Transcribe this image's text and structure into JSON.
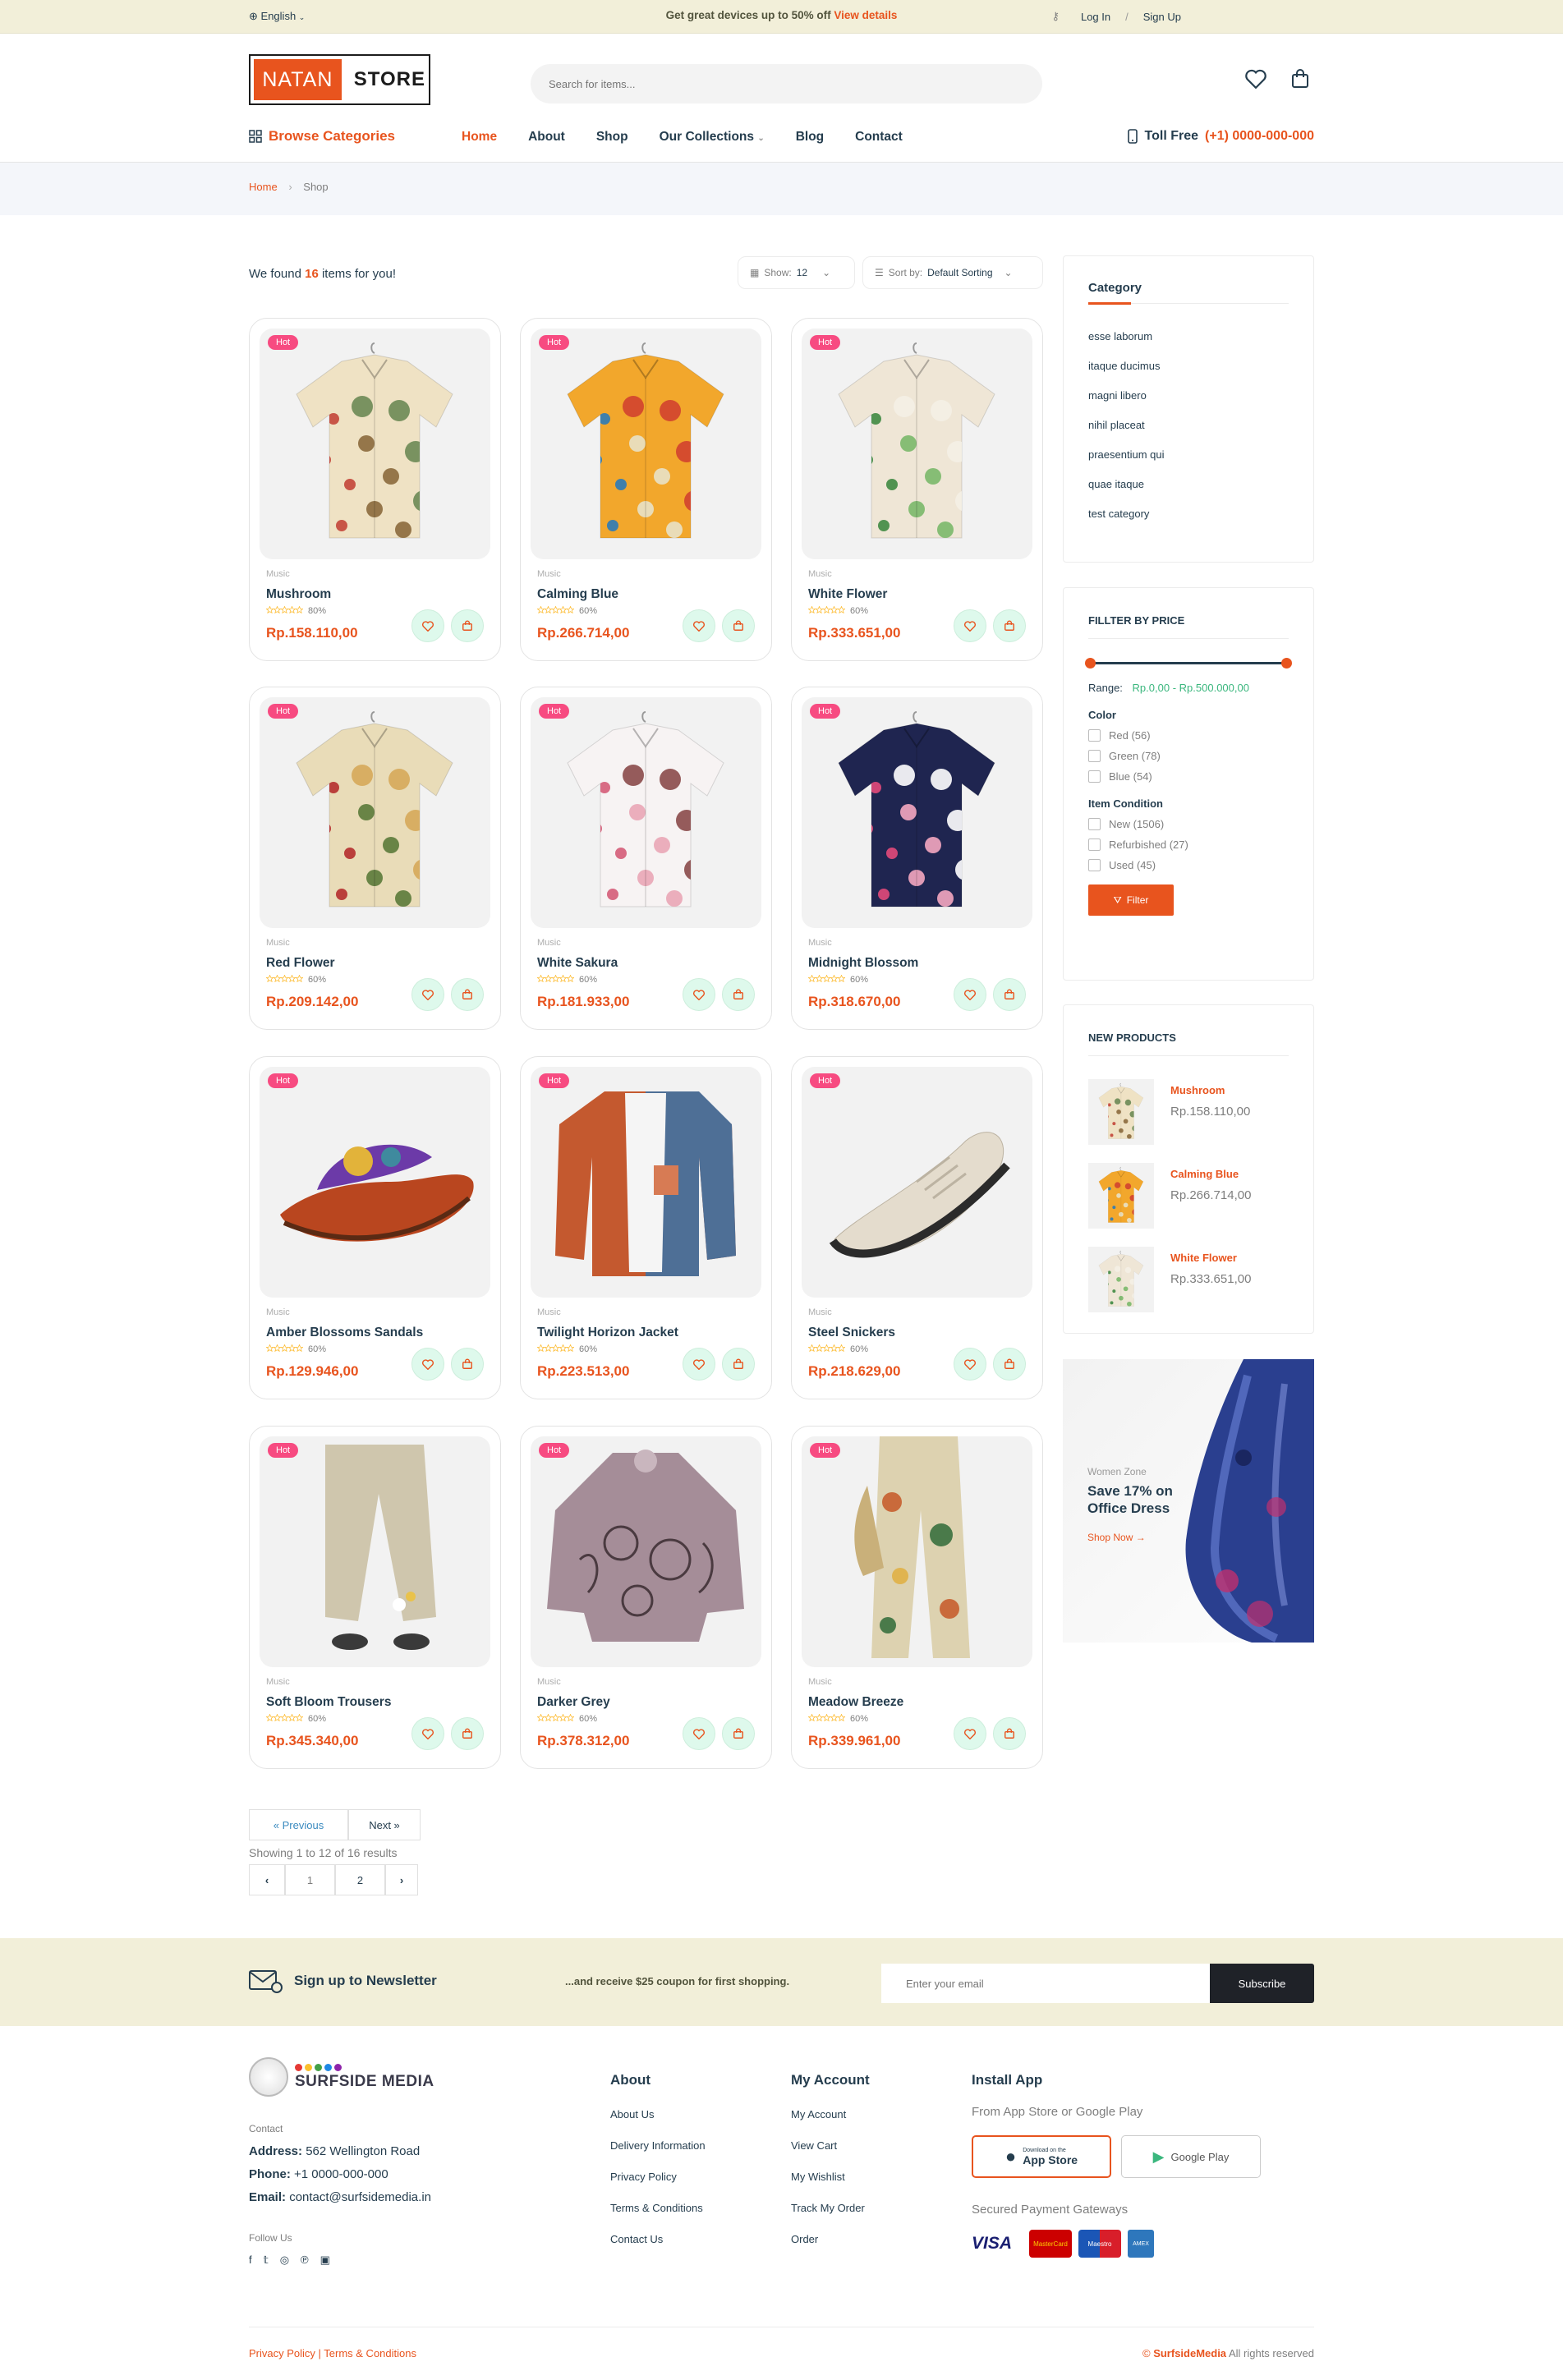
{
  "topbar": {
    "language": "English",
    "promo_text": "Get great devices up to 50% off",
    "promo_link": "View details",
    "login": "Log In",
    "separator": "/",
    "signup": "Sign Up"
  },
  "header": {
    "logo_part1": "NATAN",
    "logo_part2": "STORE",
    "search_placeholder": "Search for items..."
  },
  "nav": {
    "browse": "Browse Categories",
    "items": [
      "Home",
      "About",
      "Shop",
      "Our Collections",
      "Blog",
      "Contact"
    ],
    "toll_label": "Toll Free",
    "toll_number": "(+1) 0000-000-000"
  },
  "breadcrumb": {
    "home": "Home",
    "sep": "›",
    "current": "Shop"
  },
  "listing": {
    "found_prefix": "We found",
    "found_count": "16",
    "found_suffix": "items for you!",
    "show_label": "Show:",
    "show_value": "12",
    "sort_label": "Sort by:",
    "sort_value": "Default Sorting"
  },
  "products": [
    {
      "badge": "Hot",
      "category": "Music",
      "name": "Mushroom",
      "rating": "80%",
      "price": "Rp.158.110,00"
    },
    {
      "badge": "Hot",
      "category": "Music",
      "name": "Calming Blue",
      "rating": "60%",
      "price": "Rp.266.714,00"
    },
    {
      "badge": "Hot",
      "category": "Music",
      "name": "White Flower",
      "rating": "60%",
      "price": "Rp.333.651,00"
    },
    {
      "badge": "Hot",
      "category": "Music",
      "name": "Red Flower",
      "rating": "60%",
      "price": "Rp.209.142,00"
    },
    {
      "badge": "Hot",
      "category": "Music",
      "name": "White Sakura",
      "rating": "60%",
      "price": "Rp.181.933,00"
    },
    {
      "badge": "Hot",
      "category": "Music",
      "name": "Midnight Blossom",
      "rating": "60%",
      "price": "Rp.318.670,00"
    },
    {
      "badge": "Hot",
      "category": "Music",
      "name": "Amber Blossoms Sandals",
      "rating": "60%",
      "price": "Rp.129.946,00"
    },
    {
      "badge": "Hot",
      "category": "Music",
      "name": "Twilight Horizon Jacket",
      "rating": "60%",
      "price": "Rp.223.513,00"
    },
    {
      "badge": "Hot",
      "category": "Music",
      "name": "Steel Snickers",
      "rating": "60%",
      "price": "Rp.218.629,00"
    },
    {
      "badge": "Hot",
      "category": "Music",
      "name": "Soft Bloom Trousers",
      "rating": "60%",
      "price": "Rp.345.340,00"
    },
    {
      "badge": "Hot",
      "category": "Music",
      "name": "Darker Grey",
      "rating": "60%",
      "price": "Rp.378.312,00"
    },
    {
      "badge": "Hot",
      "category": "Music",
      "name": "Meadow Breeze",
      "rating": "60%",
      "price": "Rp.339.961,00"
    }
  ],
  "sidebar": {
    "category_title": "Category",
    "categories": [
      "esse laborum",
      "itaque ducimus",
      "magni libero",
      "nihil placeat",
      "praesentium qui",
      "quae itaque",
      "test category"
    ],
    "price_title": "FILLTER BY PRICE",
    "range_label": "Range:",
    "range_min": "Rp.0,00",
    "range_max": "Rp.500.000,00",
    "color_title": "Color",
    "colors": [
      "Red (56)",
      "Green (78)",
      "Blue (54)"
    ],
    "condition_title": "Item Condition",
    "conditions": [
      "New (1506)",
      "Refurbished (27)",
      "Used (45)"
    ],
    "filter_button": "Filter",
    "new_products_title": "NEW PRODUCTS",
    "new_products": [
      {
        "name": "Mushroom",
        "price": "Rp.158.110,00"
      },
      {
        "name": "Calming Blue",
        "price": "Rp.266.714,00"
      },
      {
        "name": "White Flower",
        "price": "Rp.333.651,00"
      }
    ],
    "banner_small": "Women Zone",
    "banner_title": "Save 17% on Office Dress",
    "banner_link": "Shop Now"
  },
  "pagination": {
    "prev": "« Previous",
    "next": "Next »",
    "summary": "Showing 1 to 12 of 16 results",
    "pages": [
      "1",
      "2"
    ],
    "left_arrow": "‹",
    "right_arrow": "›"
  },
  "newsletter": {
    "title": "Sign up to Newsletter",
    "subtitle": "...and receive $25 coupon for first shopping.",
    "placeholder": "Enter your email",
    "button": "Subscribe"
  },
  "footer": {
    "brand": "SURFSIDE MEDIA",
    "contact_label": "Contact",
    "address_label": "Address:",
    "address": "562 Wellington Road",
    "phone_label": "Phone:",
    "phone": "+1 0000-000-000",
    "email_label": "Email:",
    "email": "contact@surfsidemedia.in",
    "follow": "Follow Us",
    "about_title": "About",
    "about_links": [
      "About Us",
      "Delivery Information",
      "Privacy Policy",
      "Terms & Conditions",
      "Contact Us"
    ],
    "account_title": "My Account",
    "account_links": [
      "My Account",
      "View Cart",
      "My Wishlist",
      "Track My Order",
      "Order"
    ],
    "app_title": "Install App",
    "app_sub": "From App Store or Google Play",
    "appstore_small": "Download on the",
    "appstore": "App Store",
    "googleplay": "Google Play",
    "payments_title": "Secured Payment Gateways",
    "payments": [
      "VISA",
      "MasterCard",
      "Maestro",
      "AMEX"
    ],
    "bottom_left": "Privacy Policy | Terms & Conditions",
    "copyright_symbol": "©",
    "copyright_brand": "SurfsideMedia",
    "copyright_text": "All rights reserved"
  }
}
